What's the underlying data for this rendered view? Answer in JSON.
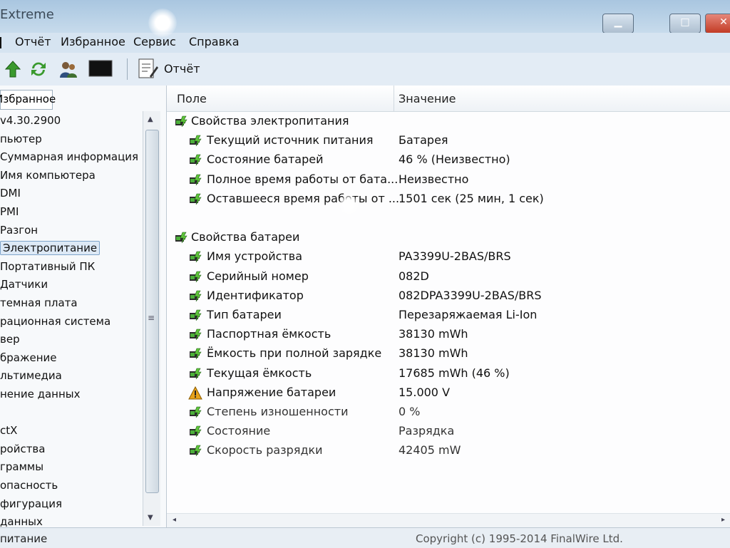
{
  "window": {
    "title": "Extreme"
  },
  "menu": [
    "Отчёт",
    "Избранное",
    "Сервис",
    "Справка"
  ],
  "toolbar": {
    "report_label": "Отчёт"
  },
  "left_panel": {
    "header": "Избранное",
    "items": [
      "v4.30.2900",
      "пьютер",
      "Суммарная информация",
      "Имя компьютера",
      "DMI",
      "PMI",
      "Разгон",
      "Электропитание",
      "Портативный ПК",
      "Датчики",
      "темная плата",
      "рационная система",
      "вер",
      "бражение",
      "льтимедиа",
      "нение данных",
      "",
      "ctX",
      "ройства",
      "граммы",
      "опасность",
      "фигурация",
      "данных"
    ]
  },
  "table": {
    "col_field": "Поле",
    "col_value": "Значение",
    "rows": [
      {
        "kind": "section",
        "field": "Свойства электропитания",
        "value": "",
        "icon": "power-properties-icon"
      },
      {
        "kind": "item",
        "field": "Текущий источник питания",
        "value": "Батарея",
        "icon": "battery-icon"
      },
      {
        "kind": "item",
        "field": "Состояние батарей",
        "value": "46 % (Неизвестно)",
        "icon": "battery-icon"
      },
      {
        "kind": "item",
        "field": "Полное время работы от бата...",
        "value": "Неизвестно",
        "icon": "battery-icon"
      },
      {
        "kind": "item",
        "field": "Оставшееся время работы от ...",
        "value": "1501 сек (25 мин, 1 сек)",
        "icon": "battery-icon"
      },
      {
        "kind": "blank",
        "field": "",
        "value": ""
      },
      {
        "kind": "section",
        "field": "Свойства батареи",
        "value": "",
        "icon": "battery-properties-icon"
      },
      {
        "kind": "item",
        "field": "Имя устройства",
        "value": "PA3399U-2BAS/BRS",
        "icon": "battery-icon"
      },
      {
        "kind": "item",
        "field": "Серийный номер",
        "value": "082D",
        "icon": "battery-icon"
      },
      {
        "kind": "item",
        "field": "Идентификатор",
        "value": "082DPA3399U-2BAS/BRS",
        "icon": "battery-icon"
      },
      {
        "kind": "item",
        "field": "Тип батареи",
        "value": "Перезаряжаемая Li-Ion",
        "icon": "battery-icon"
      },
      {
        "kind": "item",
        "field": "Паспортная ёмкость",
        "value": "38130 mWh",
        "icon": "battery-icon"
      },
      {
        "kind": "item",
        "field": "Ёмкость при полной зарядке",
        "value": "38130 mWh",
        "icon": "battery-icon"
      },
      {
        "kind": "item",
        "field": "Текущая ёмкость",
        "value": "17685 mWh  (46 %)",
        "icon": "battery-icon"
      },
      {
        "kind": "item",
        "field": "Напряжение батареи",
        "value": "15.000 V",
        "icon": "warning-icon"
      },
      {
        "kind": "item",
        "field": "Степень изношенности",
        "value": "0 %",
        "icon": "battery-icon"
      },
      {
        "kind": "item",
        "field": "Состояние",
        "value": "Разрядка",
        "icon": "battery-icon"
      },
      {
        "kind": "item",
        "field": "Скорость разрядки",
        "value": "42405 mW",
        "icon": "battery-icon"
      }
    ]
  },
  "status_bar": {
    "left": "питание",
    "right": "Copyright (c) 1995-2014 FinalWire Ltd."
  },
  "colors": {
    "title_bar": "#b7cfe6",
    "selection": "#dde9f6",
    "close_button": "#c23b25"
  }
}
